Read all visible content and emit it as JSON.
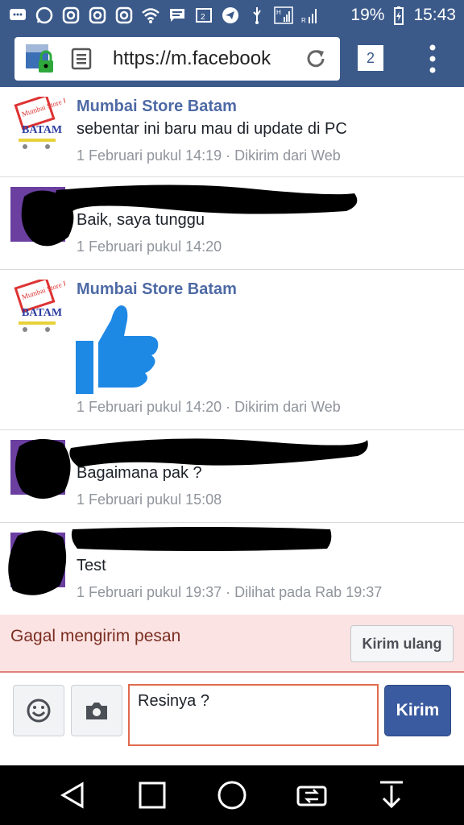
{
  "status_bar": {
    "battery": "19%",
    "time": "15:43"
  },
  "browser": {
    "url": "https://m.facebook",
    "tab_count": "2"
  },
  "messages": [
    {
      "sender": "Mumbai Store Batam",
      "text": "sebentar ini baru mau di update di PC",
      "meta": "1 Februari pukul 14:19 · Dikirim dari Web"
    },
    {
      "sender": "",
      "text": "Baik, saya tunggu",
      "meta": "1 Februari pukul 14:20"
    },
    {
      "sender": "Mumbai Store Batam",
      "text": "",
      "meta": "1 Februari pukul 14:20 · Dikirim dari Web"
    },
    {
      "sender": "",
      "text": "Bagaimana pak ?",
      "meta": "1 Februari pukul 15:08"
    },
    {
      "sender": "",
      "text": "Test",
      "meta": "1 Februari pukul 19:37 · Dilihat pada Rab 19:37"
    }
  ],
  "logo_text": "Mumbai Store BATAM",
  "failure": {
    "text": "Gagal mengirim pesan",
    "retry_label": "Kirim ulang"
  },
  "composer": {
    "value": "Resinya ?",
    "send_label": "Kirim"
  },
  "colors": {
    "fb_blue": "#3b5a8a",
    "sender_blue": "#4e6aa5",
    "like_blue": "#1e88e5",
    "error_bg": "#fbe3e3"
  }
}
